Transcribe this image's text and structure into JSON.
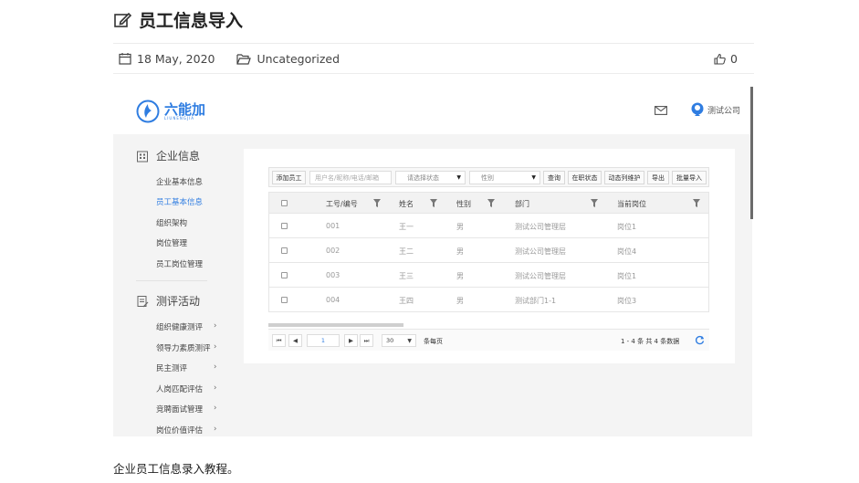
{
  "post": {
    "title": "员工信息导入",
    "date": "18 May, 2020",
    "category": "Uncategorized",
    "likes": "0",
    "caption": "企业员工信息录入教程。"
  },
  "app": {
    "logo_text": "六能加",
    "logo_sub": "LIUNENGJIA",
    "user_name": "测试公司",
    "accent": "#2f7de1"
  },
  "sidebar": {
    "section1": "企业信息",
    "items1": [
      "企业基本信息",
      "员工基本信息",
      "组织架构",
      "岗位管理",
      "员工岗位管理"
    ],
    "section2": "测评活动",
    "items2": [
      "组织健康测评",
      "领导力素质测评",
      "民主测评",
      "人岗匹配评估",
      "竞聘面试管理",
      "岗位价值评估"
    ]
  },
  "toolbar": {
    "add": "添加员工",
    "search_placeholder": "用户名/昵称/电话/邮箱",
    "status_placeholder": "请选择状态",
    "gender_placeholder": "性别",
    "query": "查询",
    "on_job": "在职状态",
    "dynamic": "动态列维护",
    "export": "导出",
    "bulk_import": "批量导入"
  },
  "table": {
    "headers": [
      "工号/编号",
      "姓名",
      "性别",
      "部门",
      "当前岗位"
    ],
    "rows": [
      [
        "001",
        "王一",
        "男",
        "测试公司管理层",
        "岗位1"
      ],
      [
        "002",
        "王二",
        "男",
        "测试公司管理层",
        "岗位4"
      ],
      [
        "003",
        "王三",
        "男",
        "测试公司管理层",
        "岗位1"
      ],
      [
        "004",
        "王四",
        "男",
        "测试部门1-1",
        "岗位3"
      ]
    ]
  },
  "pager": {
    "first": "⏮",
    "prev": "◀",
    "page": "1",
    "next": "▶",
    "last": "⏭",
    "page_size": "30",
    "per_page_label": "条每页",
    "summary": "1 - 4 条   共 4 条数据"
  }
}
